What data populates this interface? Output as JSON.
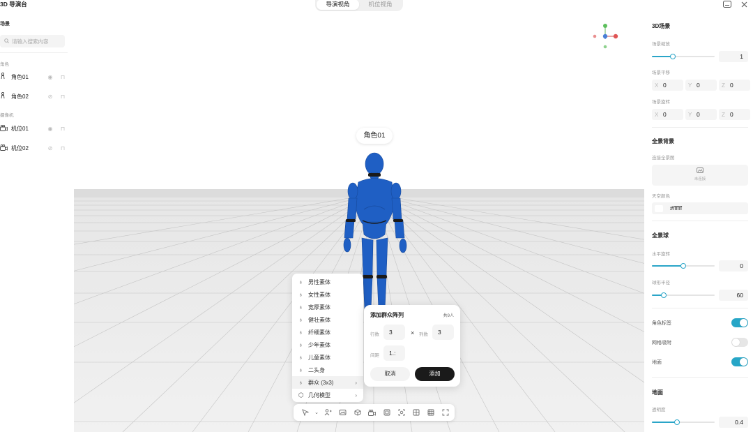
{
  "app": {
    "title": "3D 导演台"
  },
  "view_tabs": [
    {
      "label": "导演视角",
      "active": true
    },
    {
      "label": "机位视角",
      "active": false
    }
  ],
  "top_icons": [
    "subtitle-icon",
    "close-icon"
  ],
  "left_panel": {
    "title": "场景",
    "search_placeholder": "请输入搜索内容",
    "groups": [
      {
        "label": "角色",
        "items": [
          {
            "name": "角色01",
            "icon": "character-icon",
            "visible": true,
            "locked": false
          },
          {
            "name": "角色02",
            "icon": "character-icon",
            "visible": false,
            "locked": false
          }
        ]
      },
      {
        "label": "摄像机",
        "items": [
          {
            "name": "机位01",
            "icon": "camera-icon",
            "visible": true,
            "locked": false
          },
          {
            "name": "机位02",
            "icon": "camera-icon",
            "visible": false,
            "locked": false
          }
        ]
      }
    ]
  },
  "viewport": {
    "character_label": "角色01",
    "character_color": "#1f5fc4"
  },
  "character_menu": {
    "items": [
      {
        "label": "男性素体",
        "icon": "figure-icon"
      },
      {
        "label": "女性素体",
        "icon": "figure-icon"
      },
      {
        "label": "宽厚素体",
        "icon": "figure-icon"
      },
      {
        "label": "健壮素体",
        "icon": "figure-icon"
      },
      {
        "label": "纤细素体",
        "icon": "figure-icon"
      },
      {
        "label": "少年素体",
        "icon": "figure-icon"
      },
      {
        "label": "儿童素体",
        "icon": "figure-icon"
      },
      {
        "label": "二头身",
        "icon": "figure-icon"
      },
      {
        "label": "群众 (3x3)",
        "icon": "figure-icon",
        "submenu": true,
        "active": true
      },
      {
        "label": "几何模型",
        "icon": "cube-icon",
        "submenu": true
      }
    ]
  },
  "crowd_dialog": {
    "title": "添加群众阵列",
    "count": "共9人",
    "rows_label": "行数",
    "rows_value": "3",
    "times": "×",
    "cols_label": "列数",
    "cols_value": "3",
    "spacing_label": "间距",
    "spacing_value": "1.:",
    "cancel": "取消",
    "add": "添加"
  },
  "toolbar": {
    "items": [
      "select-icon",
      "chevron-down-icon",
      "add-character-icon",
      "panorama-icon",
      "cube-icon",
      "camera-icon",
      "frame-icon",
      "focus-icon",
      "grid-icon",
      "grid-large-icon",
      "fullscreen-icon"
    ]
  },
  "right_panel": {
    "scene_title": "3D场景",
    "scale_label": "场景缩放",
    "scale_value": "1",
    "scale_level": 0.33,
    "pan_label": "场景平移",
    "pan": {
      "x": "0",
      "y": "0",
      "z": "0"
    },
    "rot_label": "场景旋转",
    "rot": {
      "x": "0",
      "y": "0",
      "z": "0"
    },
    "axis_x": "X",
    "axis_y": "Y",
    "axis_z": "Z",
    "bg_title": "全景背景",
    "link_label": "连接全景图",
    "link_status": "未连接",
    "sky_label": "天空颜色",
    "sky_value": "#ffffff",
    "sphere_title": "全景球",
    "hrot_label": "水平旋转",
    "hrot_value": "0",
    "hrot_level": 0.5,
    "radius_label": "球形半径",
    "radius_value": "60",
    "radius_level": 0.19,
    "tag_label": "角色标签",
    "tag_on": true,
    "snap_label": "网格吸附",
    "snap_on": false,
    "ground_toggle_label": "地面",
    "ground_on": true,
    "ground_title": "地面",
    "opacity_label": "透明度",
    "opacity_value": "0.4",
    "opacity_level": 0.4,
    "accent": "#27a6c7"
  }
}
